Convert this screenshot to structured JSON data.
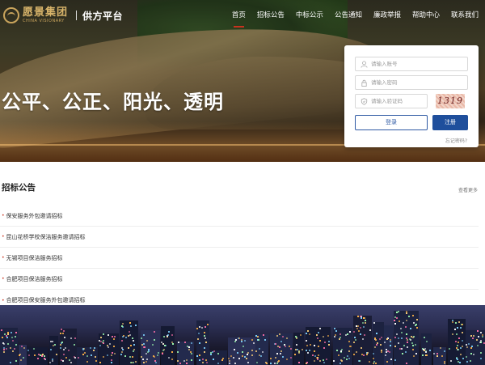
{
  "header": {
    "logo_cn": "愿景集团",
    "logo_en": "CHINA VISIONARY",
    "platform": "供方平台",
    "nav": [
      {
        "label": "首页",
        "active": true
      },
      {
        "label": "招标公告",
        "active": false
      },
      {
        "label": "中标公示",
        "active": false
      },
      {
        "label": "公告通知",
        "active": false
      },
      {
        "label": "廉政举报",
        "active": false
      },
      {
        "label": "帮助中心",
        "active": false
      },
      {
        "label": "联系我们",
        "active": false
      }
    ]
  },
  "hero": {
    "slogan": "公平、公正、阳光、透明"
  },
  "login": {
    "account_placeholder": "请输入账号",
    "password_placeholder": "请输入密码",
    "captcha_placeholder": "请输入验证码",
    "captcha_value": "1319",
    "login_label": "登录",
    "register_label": "注册",
    "forgot_label": "忘记密码?"
  },
  "notices": {
    "title": "招标公告",
    "more_label": "查看更多",
    "items": [
      "保安服务外包邀请招标",
      "昆山花桥学校保洁服务邀请招标",
      "无锡项目保洁服务招标",
      "合肥项目保洁服务招标",
      "合肥项目保安服务外包邀请招标"
    ]
  },
  "colors": {
    "accent_red": "#c8321e",
    "primary_blue": "#1f4f9c",
    "logo_gold": "#d8b46a"
  },
  "icons": {
    "account": "user-icon",
    "password": "lock-icon",
    "captcha": "shield-icon"
  }
}
